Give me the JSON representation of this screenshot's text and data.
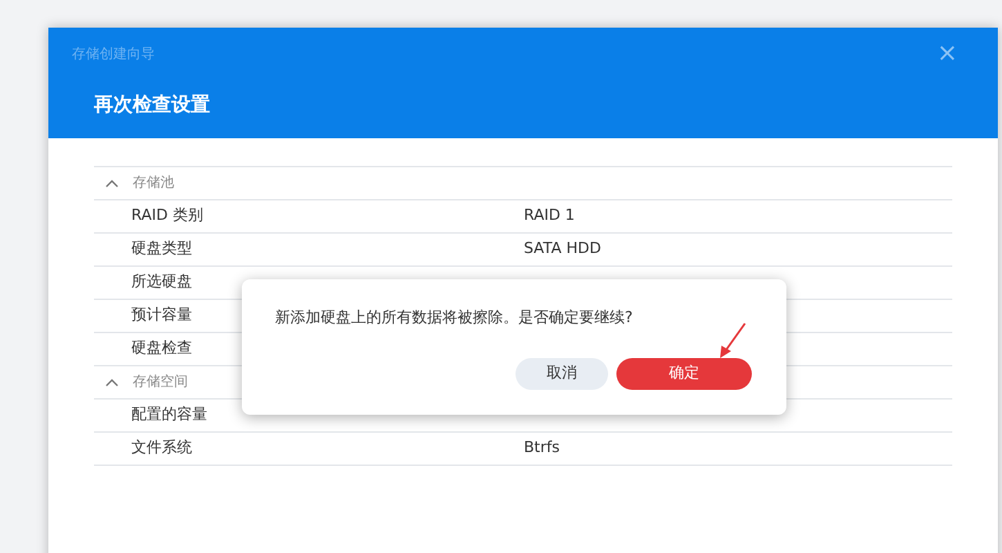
{
  "window": {
    "subtitle": "存储创建向导",
    "title": "再次检查设置",
    "close": "×"
  },
  "sections": [
    {
      "title": "存储池",
      "expanded": true,
      "rows": [
        {
          "label": "RAID 类别",
          "value": "RAID 1"
        },
        {
          "label": "硬盘类型",
          "value": "SATA HDD"
        },
        {
          "label": "所选硬盘"
        },
        {
          "label": "预计容量"
        },
        {
          "label": "硬盘检查"
        }
      ]
    },
    {
      "title": "存储空间",
      "expanded": true,
      "rows": [
        {
          "label": "配置的容量"
        },
        {
          "label": "文件系统",
          "value": "Btrfs"
        }
      ]
    }
  ],
  "dialog": {
    "message": "新添加硬盘上的所有数据将被擦除。是否确定要继续?",
    "buttons": [
      {
        "label": "取消",
        "kind": "secondary"
      },
      {
        "label": "确定",
        "kind": "primary"
      }
    ]
  }
}
